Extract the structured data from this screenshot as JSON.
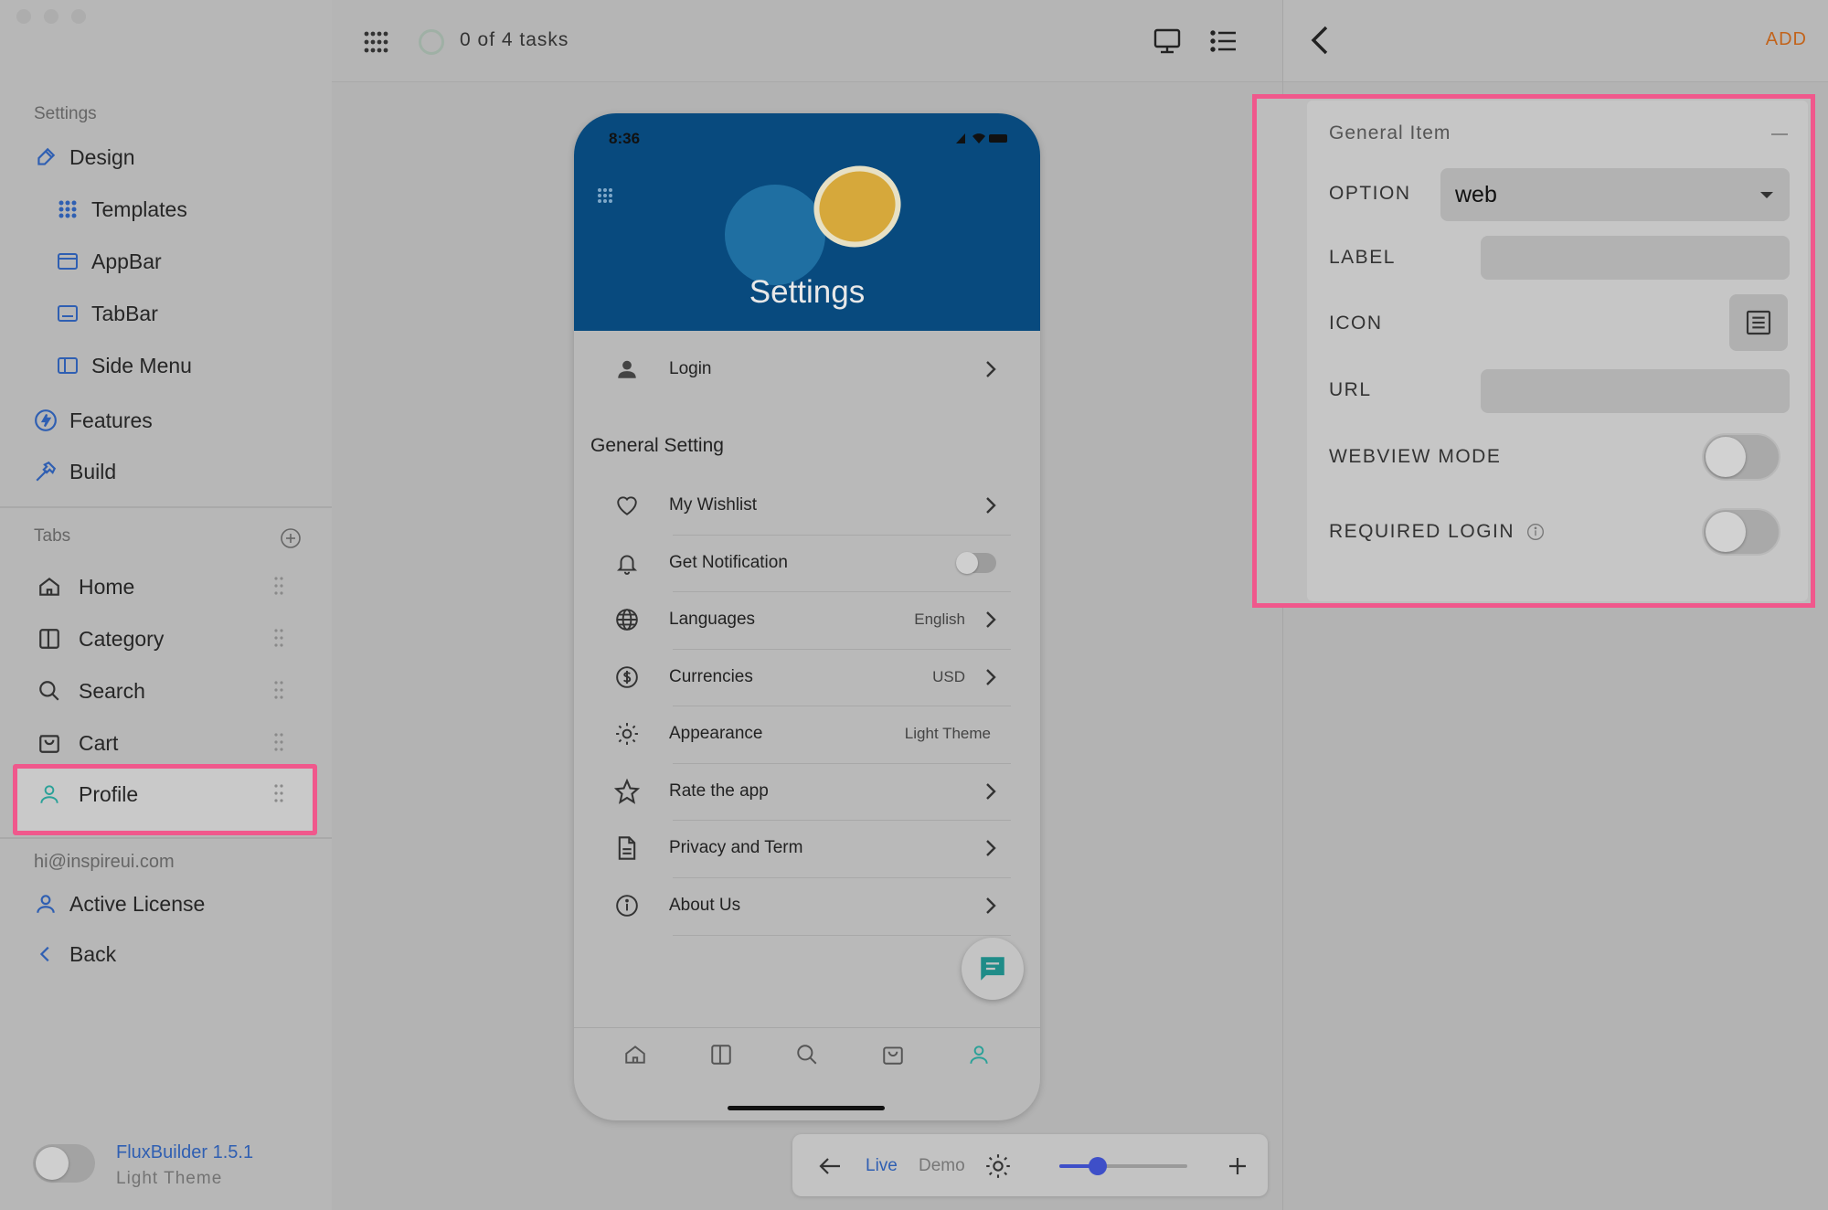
{
  "sidebar": {
    "settings_label": "Settings",
    "design": "Design",
    "design_items": [
      {
        "label": "Templates",
        "icon": "grid-icon"
      },
      {
        "label": "AppBar",
        "icon": "appbar-icon"
      },
      {
        "label": "TabBar",
        "icon": "tabbar-icon"
      },
      {
        "label": "Side Menu",
        "icon": "side-menu-icon"
      }
    ],
    "features": "Features",
    "build": "Build",
    "tabs_label": "Tabs",
    "tabs": [
      {
        "label": "Home",
        "icon": "home-icon"
      },
      {
        "label": "Category",
        "icon": "category-icon"
      },
      {
        "label": "Search",
        "icon": "search-icon"
      },
      {
        "label": "Cart",
        "icon": "cart-icon"
      },
      {
        "label": "Profile",
        "icon": "profile-icon"
      }
    ],
    "email": "hi@inspireui.com",
    "active_license": "Active License",
    "back": "Back",
    "version": "FluxBuilder 1.5.1",
    "theme": "Light Theme"
  },
  "topbar": {
    "tasks": "0 of 4 tasks"
  },
  "phone": {
    "time": "8:36",
    "hero_title": "Settings",
    "login": "Login",
    "section_title": "General Setting",
    "rows": [
      {
        "label": "My Wishlist",
        "value": "",
        "icon": "heart-icon"
      },
      {
        "label": "Get Notification",
        "value": "",
        "icon": "bell-icon"
      },
      {
        "label": "Languages",
        "value": "English",
        "icon": "globe-icon"
      },
      {
        "label": "Currencies",
        "value": "USD",
        "icon": "dollar-icon"
      },
      {
        "label": "Appearance",
        "value": "Light Theme",
        "icon": "sun-icon"
      },
      {
        "label": "Rate the app",
        "value": "",
        "icon": "star-icon"
      },
      {
        "label": "Privacy and Term",
        "value": "",
        "icon": "document-icon"
      },
      {
        "label": "About Us",
        "value": "",
        "icon": "info-icon"
      }
    ]
  },
  "preview": {
    "live": "Live",
    "demo": "Demo",
    "zoom_fraction": 0.3
  },
  "panel": {
    "add": "ADD",
    "card_title": "General Item",
    "option_label": "OPTION",
    "option_value": "web",
    "label_label": "LABEL",
    "label_value": "",
    "icon_label": "ICON",
    "url_label": "URL",
    "url_value": "",
    "webview_label": "WEBVIEW MODE",
    "required_login_label": "REQUIRED LOGIN"
  },
  "colors": {
    "highlight": "#f0588c",
    "accent": "#2f5fb2",
    "add": "#c2641c",
    "hero": "#084a7e"
  }
}
